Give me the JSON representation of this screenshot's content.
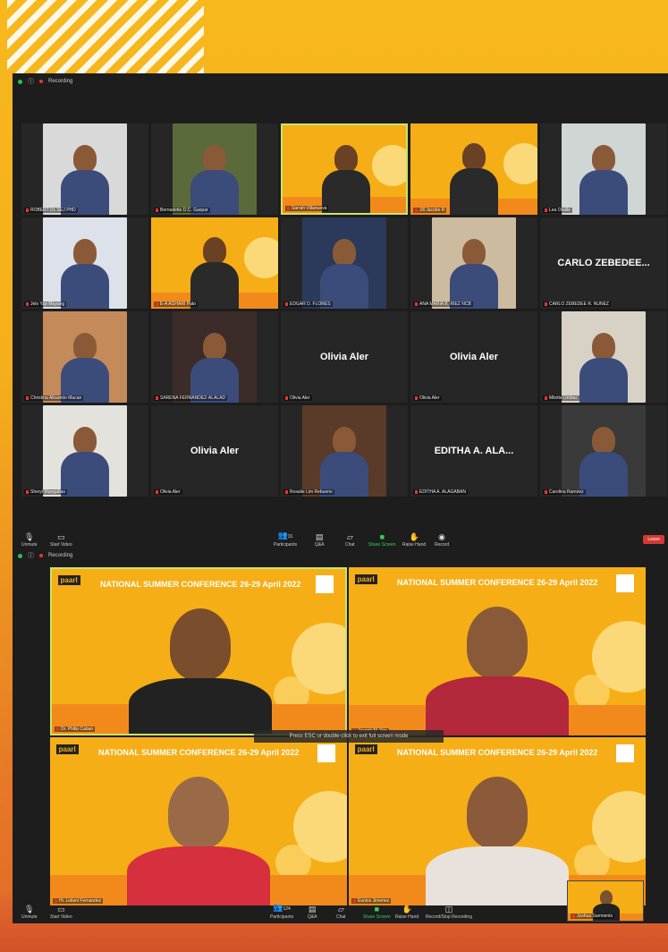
{
  "top_window": {
    "recording_label": "Recording",
    "tiles": [
      {
        "name": "ROBERT DL SEJ PHD",
        "kind": "video",
        "bg": "#d9d9d9"
      },
      {
        "name": "Bernadette D.C. Gaspar",
        "kind": "video",
        "bg": "#5b6a3a"
      },
      {
        "name": "Sarrah Villanueva",
        "kind": "slide"
      },
      {
        "name": "Jill Jacobe R",
        "kind": "slide"
      },
      {
        "name": "Lea Ovalle",
        "kind": "video",
        "bg": "#cfd6d4"
      },
      {
        "name": "Jelo Yap Mayang",
        "kind": "video",
        "bg": "#dde2ea"
      },
      {
        "name": "E-A AGHARI Pato",
        "kind": "slide"
      },
      {
        "name": "EDGAR D. FLORES",
        "kind": "video",
        "bg": "#2b3a5a"
      },
      {
        "name": "ANA MARIA B. RIEZ NCB",
        "kind": "video",
        "bg": "#cdbb9f"
      },
      {
        "name": "CARLO ZEBEDEE R. NUÑEZ",
        "kind": "text",
        "display": "CARLO ZEBEDEE..."
      },
      {
        "name": "Christina Albaredo Macan",
        "kind": "video",
        "bg": "#c48a5a"
      },
      {
        "name": "SARENA FERNANDEZ-ALALAD",
        "kind": "video",
        "bg": "#3b2c2a"
      },
      {
        "name": "Olivia Aler",
        "kind": "text",
        "display": "Olivia Aler"
      },
      {
        "name": "Olivia Aler",
        "kind": "text",
        "display": "Olivia Aler"
      },
      {
        "name": "Milette Umbac",
        "kind": "video",
        "bg": "#d8d2c6"
      },
      {
        "name": "Sheryl Mangahas",
        "kind": "video",
        "bg": "#e4e2dc"
      },
      {
        "name": "Olivia Aler",
        "kind": "text",
        "display": "Olivia Aler"
      },
      {
        "name": "Rosalie Lim Rebueno",
        "kind": "video",
        "bg": "#5a3a28"
      },
      {
        "name": "EDITHA A. ALAGABAN",
        "kind": "text",
        "display": "EDITHA A. ALA..."
      },
      {
        "name": "Carolina Ramirez",
        "kind": "video",
        "bg": "#3a3a3a"
      }
    ],
    "toolbar": {
      "mute": "Unmute",
      "video": "Start Video",
      "participants": "Participants",
      "participants_count": "31",
      "qa": "Q&A",
      "chat": "Chat",
      "share": "Share Screen",
      "raise": "Raise Hand",
      "record": "Record",
      "end": "Leave"
    }
  },
  "bottom_window": {
    "recording_label": "Recording",
    "escape_note": "Press ESC or double-click to exit full screen mode",
    "conference": {
      "org": "paarl",
      "title": "NATIONAL SUMMER CONFERENCE",
      "dates": "26-29 April 2022"
    },
    "tiles": [
      {
        "name": "Dr. Philip Caban",
        "active": true
      },
      {
        "name": "Joseph M. Yap"
      },
      {
        "name": "Hi. Leilani Fernandez"
      },
      {
        "name": "Eunice Jimenez"
      }
    ],
    "self_view_name": "Joshua Sarmiento",
    "toolbar": {
      "mute": "Unmute",
      "video": "Start Video",
      "participants": "Participants",
      "participants_count": "124",
      "qa": "Q&A",
      "chat": "Chat",
      "share": "Share Screen",
      "raise": "Raise Hand",
      "record": "Record/Stop Recording"
    }
  },
  "colors": {
    "poster_yellow": "#f5b21a",
    "zoom_dark": "#1d1d1d",
    "active_speaker": "#c9e36b",
    "end_red": "#d43a33"
  }
}
